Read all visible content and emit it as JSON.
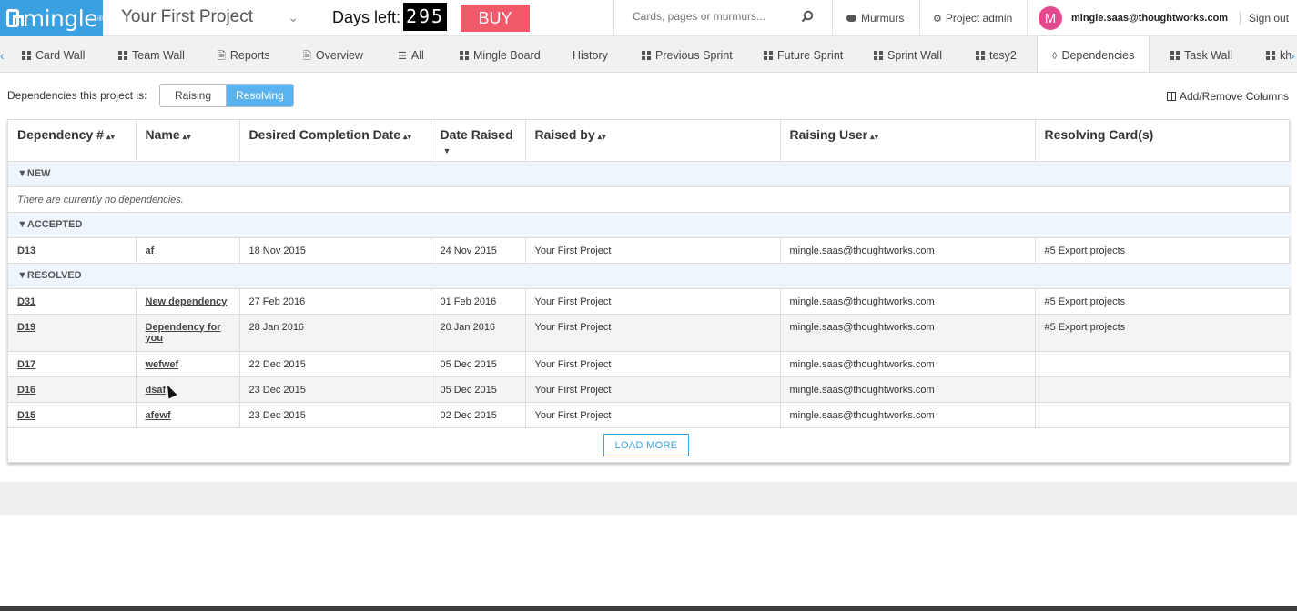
{
  "header": {
    "logo_text": "mingle",
    "logo_reg": "®",
    "project_name": "Your First Project",
    "days_left_label": "Days left:",
    "days_left_value": "295",
    "buy_label": "BUY",
    "search_placeholder": "Cards, pages or murmurs...",
    "murmurs_label": "Murmurs",
    "project_admin_label": "Project admin",
    "avatar_letter": "M",
    "user_email": "mingle.saas@thoughtworks.com",
    "sign_out_label": "Sign out"
  },
  "tabs": [
    {
      "label": "Card Wall",
      "icon": "grid-icon"
    },
    {
      "label": "Team Wall",
      "icon": "grid-icon"
    },
    {
      "label": "Reports",
      "icon": "page-icon"
    },
    {
      "label": "Overview",
      "icon": "page-icon"
    },
    {
      "label": "All",
      "icon": "list-icon"
    },
    {
      "label": "Mingle Board",
      "icon": "grid-icon"
    },
    {
      "label": "History",
      "icon": ""
    },
    {
      "label": "Previous Sprint",
      "icon": "grid-icon"
    },
    {
      "label": "Future Sprint",
      "icon": "grid-icon"
    },
    {
      "label": "Sprint Wall",
      "icon": "grid-icon"
    },
    {
      "label": "tesy2",
      "icon": "grid-icon"
    },
    {
      "label": "Dependencies",
      "icon": "dependency-icon"
    },
    {
      "label": "Task Wall",
      "icon": "grid-icon"
    },
    {
      "label": "kh",
      "icon": "grid-icon"
    }
  ],
  "toolbar": {
    "dependencies_label": "Dependencies this project is:",
    "raising_label": "Raising",
    "resolving_label": "Resolving",
    "add_remove_columns_label": "Add/Remove Columns"
  },
  "table": {
    "columns": [
      "Dependency #",
      "Name",
      "Desired Completion Date",
      "Date Raised",
      "Raised by",
      "Raising User",
      "Resolving Card(s)"
    ],
    "groups": {
      "new": {
        "label": "NEW",
        "empty_message": "There are currently no dependencies."
      },
      "accepted": {
        "label": "ACCEPTED",
        "rows": [
          [
            "D13",
            "af",
            "18 Nov 2015",
            "24 Nov 2015",
            "Your First Project",
            "mingle.saas@thoughtworks.com",
            "#5 Export projects"
          ]
        ]
      },
      "resolved": {
        "label": "RESOLVED",
        "rows": [
          [
            "D31",
            "New dependency",
            "27 Feb 2016",
            "01 Feb 2016",
            "Your First Project",
            "mingle.saas@thoughtworks.com",
            "#5 Export projects"
          ],
          [
            "D19",
            "Dependency for you",
            "28 Jan 2016",
            "20 Jan 2016",
            "Your First Project",
            "mingle.saas@thoughtworks.com",
            "#5 Export projects"
          ],
          [
            "D17",
            "wefwef",
            "22 Dec 2015",
            "05 Dec 2015",
            "Your First Project",
            "mingle.saas@thoughtworks.com",
            ""
          ],
          [
            "D16",
            "dsaf",
            "23 Dec 2015",
            "05 Dec 2015",
            "Your First Project",
            "mingle.saas@thoughtworks.com",
            ""
          ],
          [
            "D15",
            "afewf",
            "23 Dec 2015",
            "02 Dec 2015",
            "Your First Project",
            "mingle.saas@thoughtworks.com",
            ""
          ]
        ]
      }
    },
    "load_more_label": "LOAD MORE"
  },
  "colors": {
    "brand": "#3aa0e0",
    "buy": "#f2596a",
    "toggle_active": "#5ab2ee",
    "avatar": "#e5488f"
  }
}
